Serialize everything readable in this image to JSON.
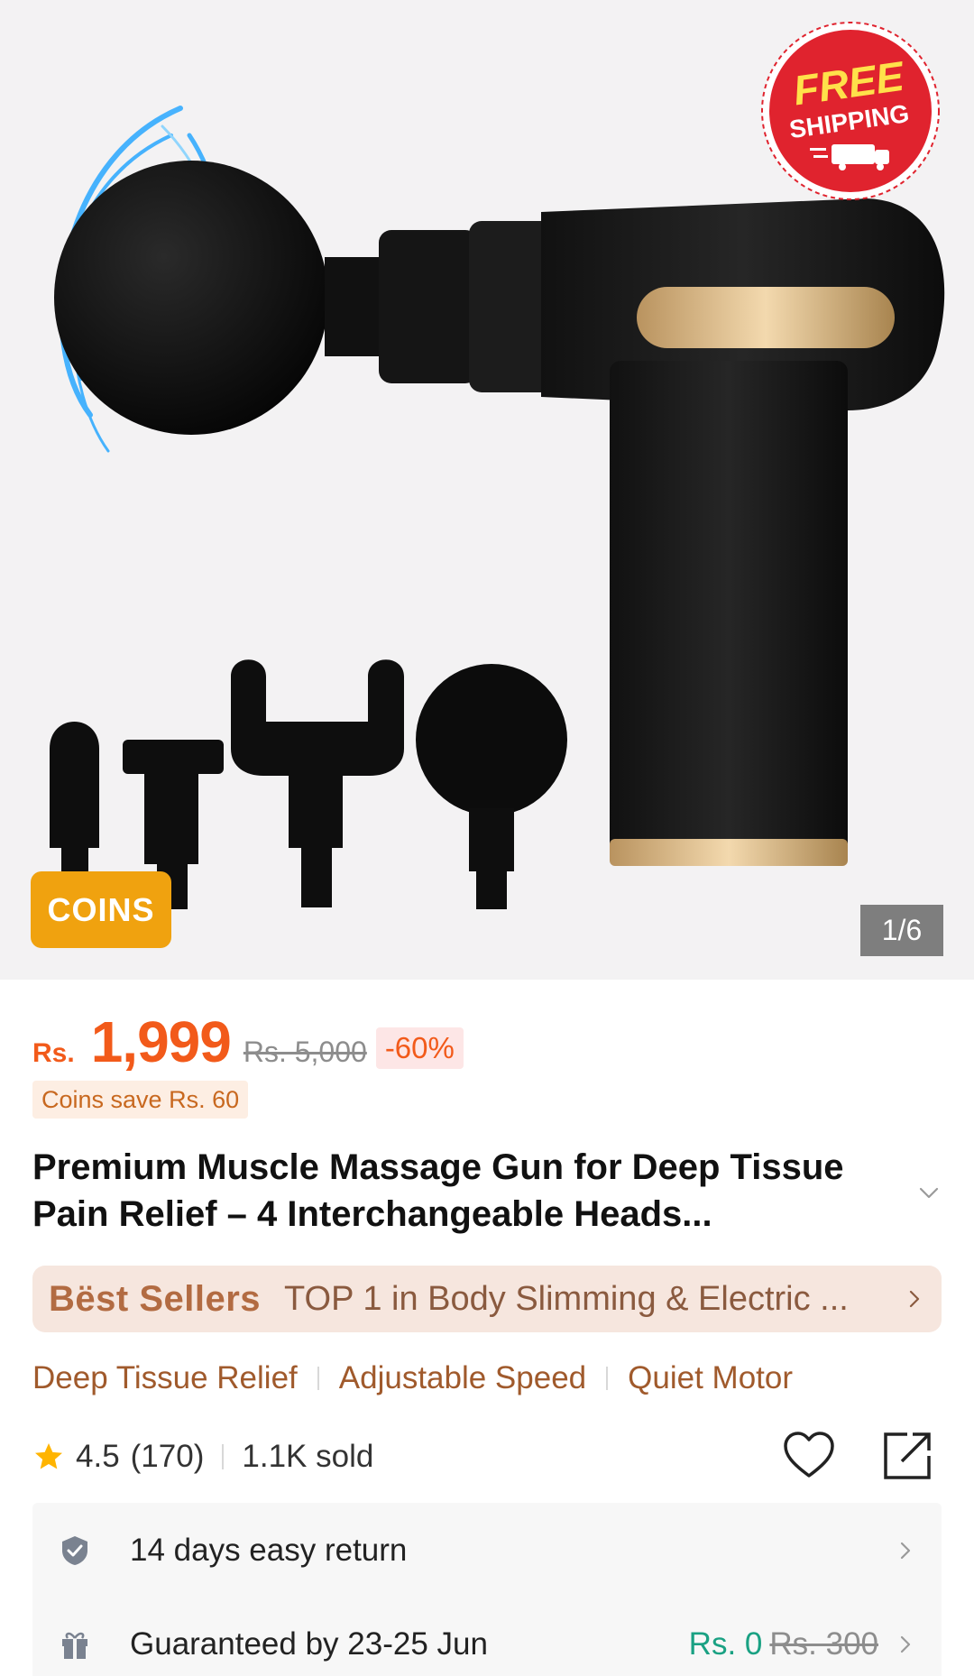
{
  "gallery": {
    "free_badge_line1": "FREE",
    "free_badge_line2": "SHIPPING",
    "coins_tag": "COINS",
    "image_counter": "1/6"
  },
  "price": {
    "currency": "Rs.",
    "current": "1,999",
    "original": "Rs. 5,000",
    "discount": "-60%",
    "coins_save": "Coins save Rs. 60"
  },
  "product": {
    "title": "Premium Muscle Massage Gun for Deep Tissue Pain Relief – 4 Interchangeable Heads..."
  },
  "best_sellers": {
    "label": "Bëst Sellers",
    "text": "TOP 1 in Body Slimming & Electric ..."
  },
  "features": [
    "Deep Tissue Relief",
    "Adjustable Speed",
    "Quiet Motor"
  ],
  "rating": {
    "score": "4.5",
    "count": "(170)",
    "sold": "1.1K sold"
  },
  "services": {
    "return_text": "14 days easy return",
    "delivery_text": "Guaranteed by 23-25 Jun",
    "delivery_fee": "Rs. 0",
    "delivery_fee_original": "Rs. 300"
  },
  "colors": {
    "price": "#f25a1a",
    "coins_badge": "#f0a20f",
    "best_sellers_bg": "#f6e6de",
    "feature_text": "#a05a2c",
    "free_delivery": "#1aa183"
  },
  "icons": [
    "star-icon",
    "heart-icon",
    "share-icon",
    "shield-check-icon",
    "gift-icon",
    "chevron-right-icon",
    "chevron-down-icon"
  ]
}
